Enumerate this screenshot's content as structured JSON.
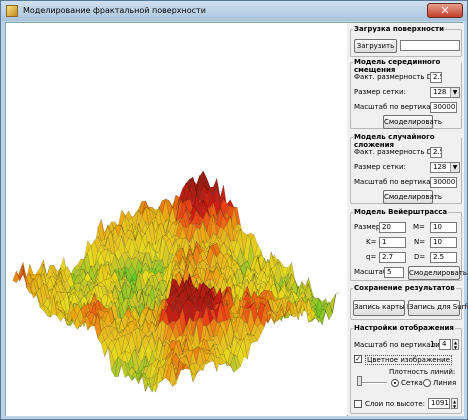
{
  "window": {
    "title": "Моделирование фрактальной поверхности",
    "close": "✕"
  },
  "load": {
    "title": "Загрузка поверхности",
    "button": "Загрузить",
    "path": ""
  },
  "midpoint": {
    "title": "Модель серединного смещения",
    "dim_label": "Факт. размерность D =",
    "dim": "2.5",
    "grid_label": "Размер сетки:",
    "grid": "128",
    "scale_label": "Масштаб по вертикали",
    "scale": "30000",
    "button": "Смоделировать"
  },
  "random": {
    "title": "Модель случайного сложения",
    "dim_label": "Факт. размерность D =",
    "dim": "2.5",
    "grid_label": "Размер сетки:",
    "grid": "128",
    "scale_label": "Масштаб по вертикали",
    "scale": "30000",
    "button": "Смоделировать"
  },
  "weier": {
    "title": "Модель Вейерштрасса",
    "size_label": "Размер",
    "size": "20",
    "m_label": "M=",
    "m": "10",
    "k_label": "K=",
    "k": "1",
    "n_label": "N=",
    "n": "10",
    "q_label": "q=",
    "q": "2.7",
    "d_label": "D=",
    "d": "2.5",
    "scale_label": "Масштаб",
    "scale": "5",
    "button": "Смоделировать"
  },
  "save": {
    "title": "Сохранение результатов",
    "map_button": "Запись карты MAP",
    "surfer_button": "Запись для Surfer"
  },
  "display": {
    "title": "Настройки отображения",
    "scale_label": "Масштаб по вертикали",
    "scale_prefix": "1:",
    "scale": "4",
    "color_label": "Цветное изображение",
    "color_checked": true,
    "density_label": "Плотность линий:",
    "grid_label": "Сетка",
    "line_label": "Линия",
    "grid_selected": true,
    "height_label": "Слои по высоте:",
    "height": "1091"
  }
}
